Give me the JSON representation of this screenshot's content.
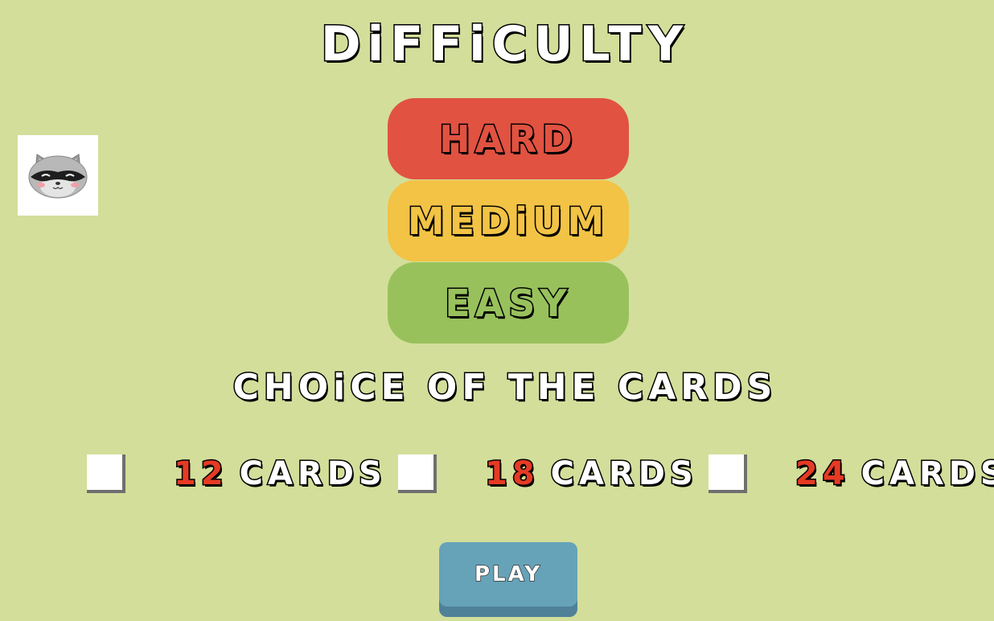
{
  "title": "DiFFiCULTY",
  "avatar": {
    "icon": "raccoon-icon"
  },
  "difficulty": {
    "hard": "HARD",
    "medium": "MEDiUM",
    "easy": "EASY"
  },
  "cards_section": {
    "title": "CHOiCE OF THE CARDS",
    "options": [
      {
        "count": "12",
        "word": "CARDS",
        "checked": false
      },
      {
        "count": "18",
        "word": "CARDS",
        "checked": false
      },
      {
        "count": "24",
        "word": "CARDS",
        "checked": false
      }
    ]
  },
  "play_label": "PLAY",
  "colors": {
    "background": "#d3de9a",
    "hard": "#e15241",
    "medium": "#f2c345",
    "easy": "#98c15c",
    "card_count": "#e63a24",
    "play": "#66a3b9"
  }
}
